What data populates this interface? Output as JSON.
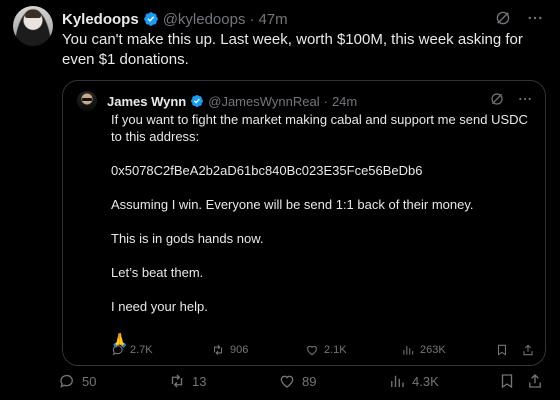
{
  "post": {
    "author": {
      "name": "Kyledoops",
      "handle": "@kyledoops",
      "separator": "·",
      "time": "47m"
    },
    "text": "You can't make this up. Last week, worth $100M, this week asking for even $1 donations.",
    "quote": {
      "author": {
        "name": "James Wynn",
        "handle": "@JamesWynnReal",
        "separator": "·",
        "time": "24m"
      },
      "paragraphs": [
        "If you want to fight the market making cabal and support me send USDC to this address:",
        "0x5078C2fBeA2b2aD61bc840Bc023E35Fce56BeDb6",
        "Assuming I win. Everyone will be send 1:1 back of their money.",
        "This is in gods hands now.",
        "Let’s beat them.",
        "I need your help.",
        "🙏"
      ],
      "stats": {
        "replies": "2.7K",
        "reposts": "906",
        "likes": "2.1K",
        "views": "263K"
      }
    },
    "stats": {
      "replies": "50",
      "reposts": "13",
      "likes": "89",
      "views": "4.3K"
    }
  },
  "colors": {
    "background": "#000000",
    "text": "#e7e9ea",
    "muted": "#71767b",
    "verified": "#1d9bf0",
    "border": "#2f3336"
  },
  "icons": {
    "verified": "verified-badge-icon",
    "grok": "grok-icon",
    "more": "more-icon",
    "reply": "reply-icon",
    "repost": "repost-icon",
    "like": "like-icon",
    "views": "views-icon",
    "bookmark": "bookmark-icon",
    "share": "share-icon"
  }
}
